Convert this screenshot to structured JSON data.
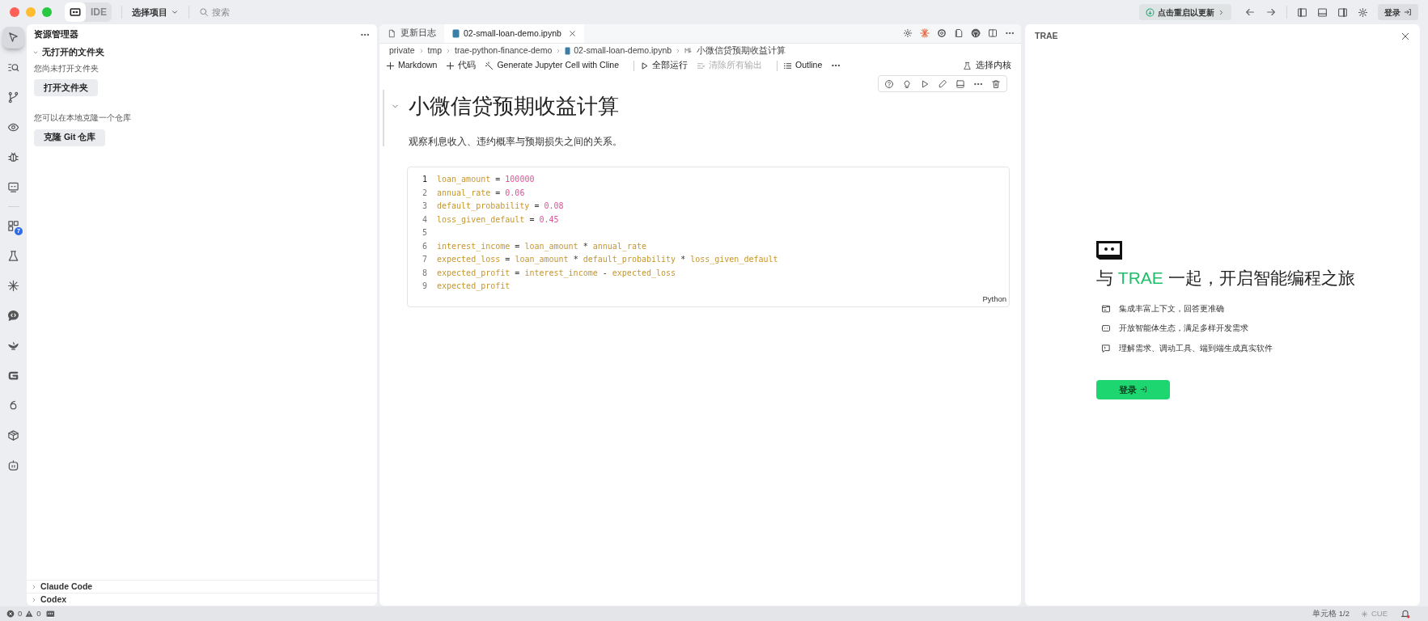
{
  "titlebar": {
    "mode_switch": [
      {
        "selected": true
      },
      {
        "label": "IDE",
        "selected": false
      }
    ],
    "project": "选择项目",
    "search_placeholder": "搜索",
    "update": "点击重启以更新",
    "login": "登录"
  },
  "activity_bar": [
    {
      "selected": true
    },
    {
      "selected": false
    },
    {
      "selected": false
    },
    {
      "selected": false
    },
    {
      "selected": false
    },
    {
      "selected": false
    },
    {
      "selected": false,
      "badge": "7"
    },
    {
      "selected": false
    },
    {
      "selected": false
    },
    {
      "selected": false
    },
    {
      "selected": false
    },
    {
      "selected": false
    },
    {
      "selected": false
    },
    {
      "selected": false
    },
    {
      "selected": false
    }
  ],
  "explorer": {
    "title": "资源管理器",
    "section": {
      "label": "无打开的文件夹",
      "expanded": true
    },
    "no_folder_text": "您尚未打开文件夹",
    "open_button": "打开文件夹",
    "clone_text": "您可以在本地克隆一个仓库",
    "clone_button": "克隆 Git 仓库",
    "bottom_sections": [
      {
        "label": "Claude Code",
        "expanded": false
      },
      {
        "label": "Codex",
        "expanded": false
      }
    ]
  },
  "editor": {
    "tabs": [
      {
        "label": "更新日志",
        "selected": false
      },
      {
        "label": "02-small-loan-demo.ipynb",
        "selected": true
      }
    ],
    "breadcrumbs": [
      "private",
      "tmp",
      "trae-python-finance-demo",
      "02-small-loan-demo.ipynb",
      "小微信贷预期收益计算"
    ],
    "toolbar": [
      {
        "label": "Markdown",
        "disabled": false
      },
      {
        "label": "代码",
        "disabled": false
      },
      {
        "label": "Generate Jupyter Cell with Cline",
        "disabled": false
      },
      {
        "label": "全部运行",
        "disabled": false
      },
      {
        "label": "清除所有输出",
        "disabled": true
      },
      {
        "label": "Outline",
        "disabled": false
      }
    ],
    "kernel": "选择内核",
    "markdown_cell": {
      "heading": "小微信贷预期收益计算",
      "expanded": true,
      "paragraph": "观察利息收入、违约概率与预期损失之间的关系。"
    },
    "code_cell": {
      "language": "Python",
      "lines": [
        {
          "number": "1",
          "current": true,
          "tokens": [
            {
              "kind": "name",
              "text": "loan_amount"
            },
            {
              "kind": "op",
              "text": "="
            },
            {
              "kind": "num",
              "text": "100000"
            }
          ]
        },
        {
          "number": "2",
          "current": false,
          "tokens": [
            {
              "kind": "name",
              "text": "annual_rate"
            },
            {
              "kind": "op",
              "text": "="
            },
            {
              "kind": "num",
              "text": "0.06"
            }
          ]
        },
        {
          "number": "3",
          "current": false,
          "tokens": [
            {
              "kind": "name",
              "text": "default_probability"
            },
            {
              "kind": "op",
              "text": "="
            },
            {
              "kind": "num",
              "text": "0.08"
            }
          ]
        },
        {
          "number": "4",
          "current": false,
          "tokens": [
            {
              "kind": "name",
              "text": "loss_given_default"
            },
            {
              "kind": "op",
              "text": "="
            },
            {
              "kind": "num",
              "text": "0.45"
            }
          ]
        },
        {
          "number": "5",
          "current": false
        },
        {
          "number": "6",
          "current": false,
          "tokens": [
            {
              "kind": "name",
              "text": "interest_income"
            },
            {
              "kind": "op",
              "text": "="
            },
            {
              "kind": "name",
              "text": "loan_amount"
            },
            {
              "kind": "op",
              "text": "*"
            },
            {
              "kind": "name",
              "text": "annual_rate"
            }
          ]
        },
        {
          "number": "7",
          "current": false,
          "tokens": [
            {
              "kind": "name",
              "text": "expected_loss"
            },
            {
              "kind": "op",
              "text": "="
            },
            {
              "kind": "name",
              "text": "loan_amount"
            },
            {
              "kind": "op",
              "text": "*"
            },
            {
              "kind": "name",
              "text": "default_probability"
            },
            {
              "kind": "op",
              "text": "*"
            },
            {
              "kind": "name",
              "text": "loss_given_default"
            }
          ]
        },
        {
          "number": "8",
          "current": false,
          "tokens": [
            {
              "kind": "name",
              "text": "expected_profit"
            },
            {
              "kind": "op",
              "text": "="
            },
            {
              "kind": "name",
              "text": "interest_income"
            },
            {
              "kind": "op",
              "text": "-"
            },
            {
              "kind": "name",
              "text": "expected_loss"
            }
          ]
        },
        {
          "number": "9",
          "current": false,
          "tokens": [
            {
              "kind": "name",
              "text": "expected_profit"
            }
          ]
        }
      ]
    }
  },
  "assistant": {
    "title": "TRAE",
    "headline": {
      "before": "与",
      "brand": "TRAE",
      "after": "一起，开启智能编程之旅"
    },
    "features": [
      "集成丰富上下文，回答更准确",
      "开放智能体生态，满足多样开发需求",
      "理解需求、调动工具、端到端生成真实软件"
    ],
    "login_button": "登录"
  },
  "status_bar": {
    "errors": "0",
    "warnings": "0",
    "cell_position": "单元格 1/2",
    "cue": "CUE"
  }
}
